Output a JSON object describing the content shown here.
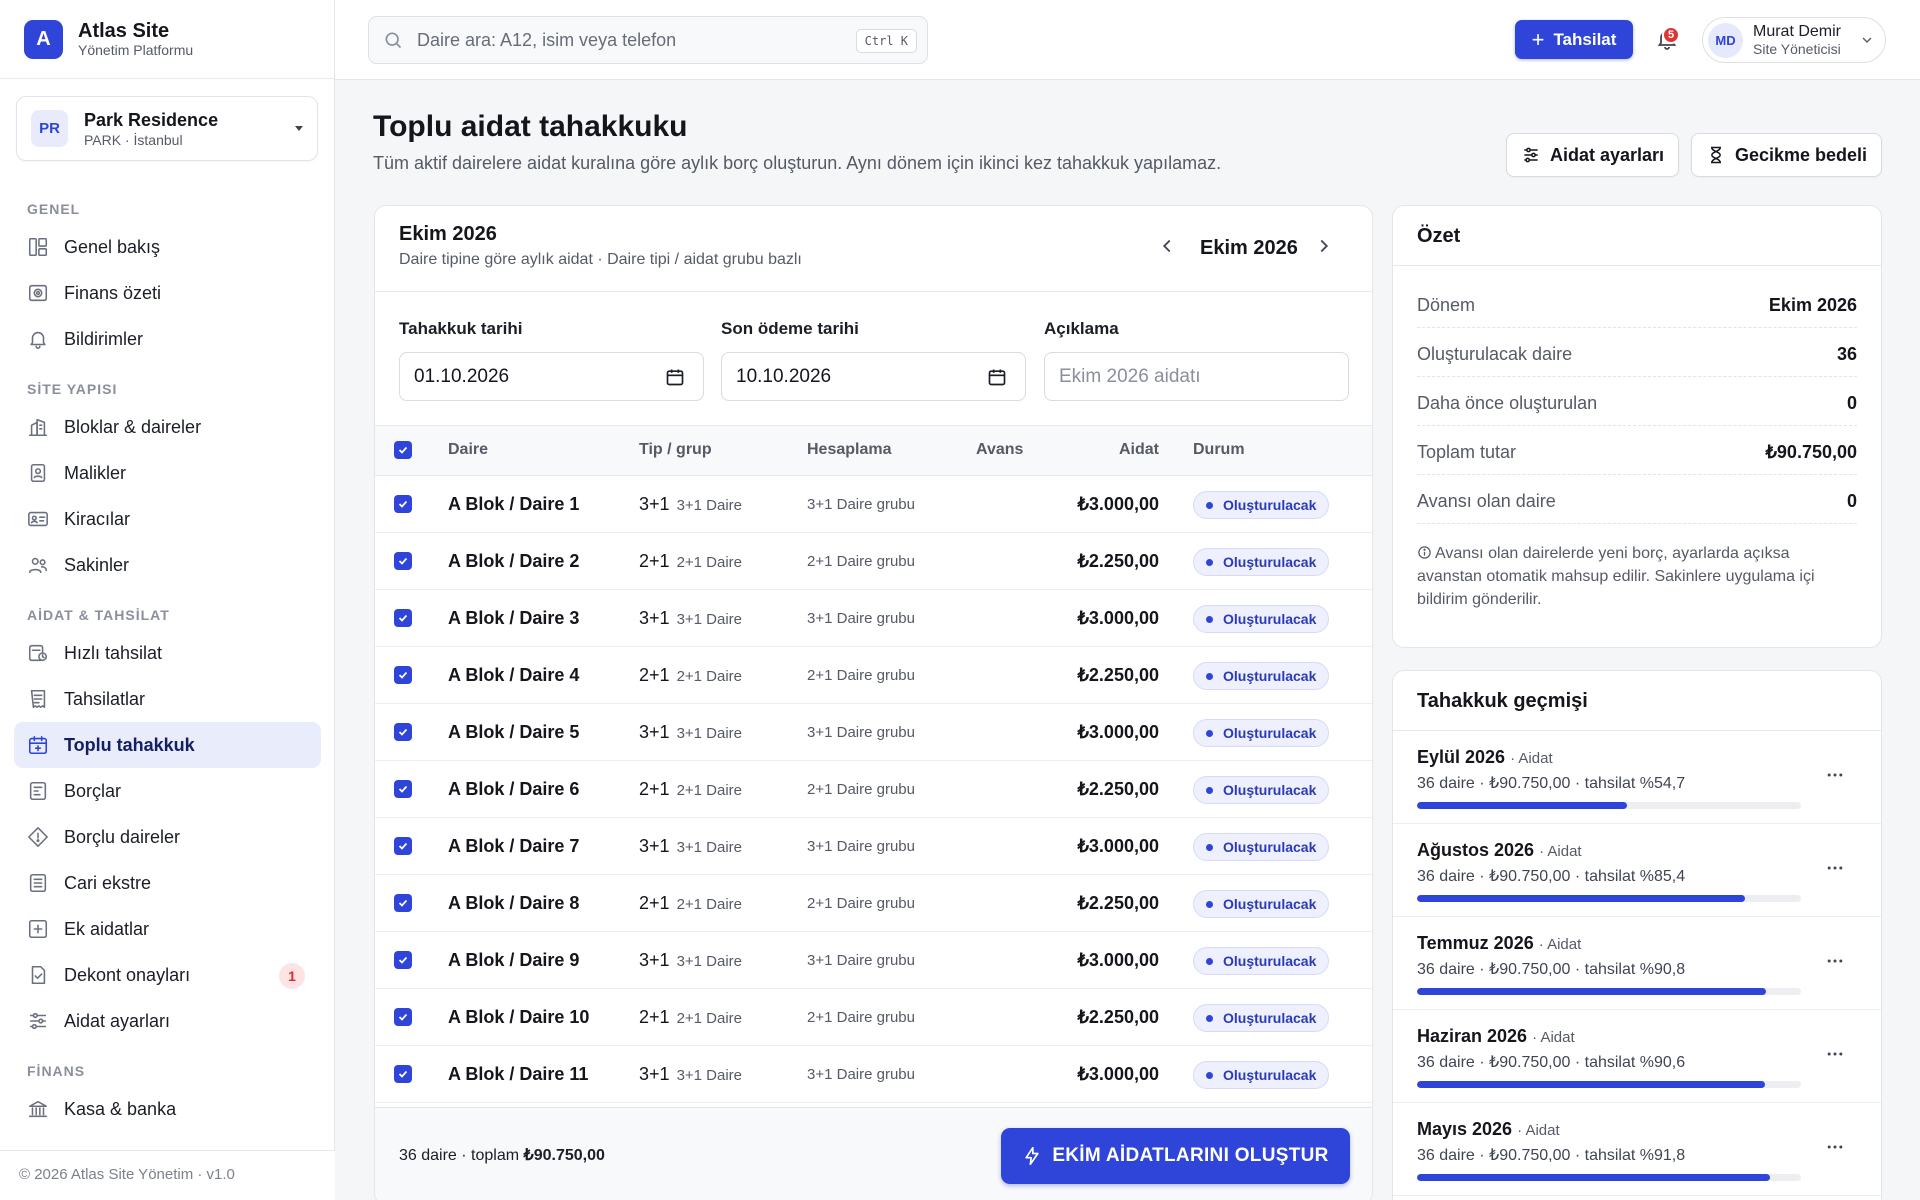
{
  "brand": {
    "logo_letter": "A",
    "title": "Atlas Site",
    "subtitle": "Yönetim Platformu"
  },
  "site": {
    "initials": "PR",
    "name": "Park Residence",
    "location": "PARK · İstanbul"
  },
  "nav": {
    "sections": [
      {
        "title": "GENEL",
        "items": [
          {
            "label": "Genel bakış",
            "icon": "layout-icon"
          },
          {
            "label": "Finans özeti",
            "icon": "finance-icon"
          },
          {
            "label": "Bildirimler",
            "icon": "bell-icon"
          }
        ]
      },
      {
        "title": "SİTE YAPISI",
        "items": [
          {
            "label": "Bloklar & daireler",
            "icon": "building-icon"
          },
          {
            "label": "Malikler",
            "icon": "owner-icon"
          },
          {
            "label": "Kiracılar",
            "icon": "id-card-icon"
          },
          {
            "label": "Sakinler",
            "icon": "users-icon"
          }
        ]
      },
      {
        "title": "AİDAT & TAHSİLAT",
        "items": [
          {
            "label": "Hızlı tahsilat",
            "icon": "quick-pay-icon"
          },
          {
            "label": "Tahsilatlar",
            "icon": "receipt-icon"
          },
          {
            "label": "Toplu tahakkuk",
            "icon": "calendar-plus-icon",
            "active": true
          },
          {
            "label": "Borçlar",
            "icon": "debt-icon"
          },
          {
            "label": "Borçlu daireler",
            "icon": "alert-diamond-icon"
          },
          {
            "label": "Cari ekstre",
            "icon": "statement-icon"
          },
          {
            "label": "Ek aidatlar",
            "icon": "plus-square-icon"
          },
          {
            "label": "Dekont onayları",
            "icon": "doc-check-icon",
            "badge": "1"
          },
          {
            "label": "Aidat ayarları",
            "icon": "sliders-icon"
          }
        ]
      },
      {
        "title": "FİNANS",
        "items": [
          {
            "label": "Kasa & banka",
            "icon": "bank-icon"
          }
        ]
      }
    ]
  },
  "footer": {
    "text": "© 2026 Atlas Site Yönetim · v1.0"
  },
  "topbar": {
    "search_placeholder": "Daire ara: A12, isim veya telefon",
    "shortcut": "Ctrl K",
    "collect_button": "Tahsilat",
    "notif_count": "5",
    "user": {
      "initials": "MD",
      "name": "Murat Demir",
      "role": "Site Yöneticisi"
    }
  },
  "page": {
    "title": "Toplu aidat tahakkuku",
    "subtitle": "Tüm aktif dairelere aidat kuralına göre aylık borç oluşturun. Aynı dönem için ikinci kez tahakkuk yapılamaz.",
    "btn_settings": "Aidat ayarları",
    "btn_late_fee": "Gecikme bedeli"
  },
  "accrual": {
    "title": "Ekim 2026",
    "subtitle": "Daire tipine göre aylık aidat · Daire tipi / aidat grubu bazlı",
    "period": "Ekim 2026",
    "fields": {
      "date_label": "Tahakkuk tarihi",
      "date_value": "01.10.2026",
      "due_label": "Son ödeme tarihi",
      "due_value": "10.10.2026",
      "desc_label": "Açıklama",
      "desc_placeholder": "Ekim 2026 aidatı"
    },
    "columns": {
      "daire": "Daire",
      "tip": "Tip / grup",
      "hesap": "Hesaplama",
      "avans": "Avans",
      "aidat": "Aidat",
      "durum": "Durum"
    },
    "rows": [
      {
        "daire": "A Blok / Daire 1",
        "tip": "3+1",
        "tip_sub": "3+1 Daire",
        "hesap": "3+1 Daire grubu",
        "avans": "",
        "aidat": "₺3.000,00",
        "durum": "Oluşturulacak"
      },
      {
        "daire": "A Blok / Daire 2",
        "tip": "2+1",
        "tip_sub": "2+1 Daire",
        "hesap": "2+1 Daire grubu",
        "avans": "",
        "aidat": "₺2.250,00",
        "durum": "Oluşturulacak"
      },
      {
        "daire": "A Blok / Daire 3",
        "tip": "3+1",
        "tip_sub": "3+1 Daire",
        "hesap": "3+1 Daire grubu",
        "avans": "",
        "aidat": "₺3.000,00",
        "durum": "Oluşturulacak"
      },
      {
        "daire": "A Blok / Daire 4",
        "tip": "2+1",
        "tip_sub": "2+1 Daire",
        "hesap": "2+1 Daire grubu",
        "avans": "",
        "aidat": "₺2.250,00",
        "durum": "Oluşturulacak"
      },
      {
        "daire": "A Blok / Daire 5",
        "tip": "3+1",
        "tip_sub": "3+1 Daire",
        "hesap": "3+1 Daire grubu",
        "avans": "",
        "aidat": "₺3.000,00",
        "durum": "Oluşturulacak"
      },
      {
        "daire": "A Blok / Daire 6",
        "tip": "2+1",
        "tip_sub": "2+1 Daire",
        "hesap": "2+1 Daire grubu",
        "avans": "",
        "aidat": "₺2.250,00",
        "durum": "Oluşturulacak"
      },
      {
        "daire": "A Blok / Daire 7",
        "tip": "3+1",
        "tip_sub": "3+1 Daire",
        "hesap": "3+1 Daire grubu",
        "avans": "",
        "aidat": "₺3.000,00",
        "durum": "Oluşturulacak"
      },
      {
        "daire": "A Blok / Daire 8",
        "tip": "2+1",
        "tip_sub": "2+1 Daire",
        "hesap": "2+1 Daire grubu",
        "avans": "",
        "aidat": "₺2.250,00",
        "durum": "Oluşturulacak"
      },
      {
        "daire": "A Blok / Daire 9",
        "tip": "3+1",
        "tip_sub": "3+1 Daire",
        "hesap": "3+1 Daire grubu",
        "avans": "",
        "aidat": "₺3.000,00",
        "durum": "Oluşturulacak"
      },
      {
        "daire": "A Blok / Daire 10",
        "tip": "2+1",
        "tip_sub": "2+1 Daire",
        "hesap": "2+1 Daire grubu",
        "avans": "",
        "aidat": "₺2.250,00",
        "durum": "Oluşturulacak"
      },
      {
        "daire": "A Blok / Daire 11",
        "tip": "3+1",
        "tip_sub": "3+1 Daire",
        "hesap": "3+1 Daire grubu",
        "avans": "",
        "aidat": "₺3.000,00",
        "durum": "Oluşturulacak"
      }
    ],
    "footer": {
      "count": "36 daire",
      "total_label": "toplam",
      "total": "₺90.750,00"
    },
    "create_button": "EKİM AİDATLARINI OLUŞTUR"
  },
  "summary": {
    "title": "Özet",
    "rows": [
      {
        "key": "Dönem",
        "value": "Ekim 2026"
      },
      {
        "key": "Oluşturulacak daire",
        "value": "36"
      },
      {
        "key": "Daha önce oluşturulan",
        "value": "0"
      },
      {
        "key": "Toplam tutar",
        "value": "₺90.750,00"
      },
      {
        "key": "Avansı olan daire",
        "value": "0"
      }
    ],
    "note": "Avansı olan dairelerde yeni borç, ayarlarda açıksa avanstan otomatik mahsup edilir. Sakinlere uygulama içi bildirim gönderilir."
  },
  "history": {
    "title": "Tahakkuk geçmişi",
    "items": [
      {
        "month": "Eylül 2026",
        "type": "Aidat",
        "meta": "36 daire · ₺90.750,00 · tahsilat %54,7",
        "progress": 54.7
      },
      {
        "month": "Ağustos 2026",
        "type": "Aidat",
        "meta": "36 daire · ₺90.750,00 · tahsilat %85,4",
        "progress": 85.4
      },
      {
        "month": "Temmuz 2026",
        "type": "Aidat",
        "meta": "36 daire · ₺90.750,00 · tahsilat %90,8",
        "progress": 90.8
      },
      {
        "month": "Haziran 2026",
        "type": "Aidat",
        "meta": "36 daire · ₺90.750,00 · tahsilat %90,6",
        "progress": 90.6
      },
      {
        "month": "Mayıs 2026",
        "type": "Aidat",
        "meta": "36 daire · ₺90.750,00 · tahsilat %91,8",
        "progress": 91.8
      }
    ]
  },
  "colors": {
    "accent": "#2f44d8",
    "active_bg": "#e9ecfa",
    "danger": "#e03434"
  }
}
